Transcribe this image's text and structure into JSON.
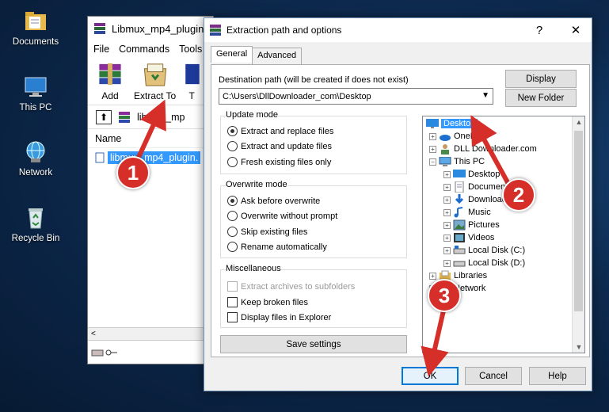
{
  "desktop": {
    "icons": [
      {
        "label": "Documents",
        "icon": "documents-folder-icon"
      },
      {
        "label": "This PC",
        "icon": "computer-icon"
      },
      {
        "label": "Network",
        "icon": "network-icon"
      },
      {
        "label": "Recycle Bin",
        "icon": "recycle-bin-icon"
      }
    ]
  },
  "winrar": {
    "title": "Libmux_mp4_plugin",
    "menu": [
      "File",
      "Commands",
      "Tools"
    ],
    "toolbar": {
      "add": "Add",
      "extract_to": "Extract To",
      "test": "T"
    },
    "path": "libmux_mp",
    "list_header": "Name",
    "file": "libmux_mp4_plugin.",
    "hscroll": "<"
  },
  "dialog": {
    "title": "Extraction path and options",
    "help": "?",
    "close": "✕",
    "tabs": [
      "General",
      "Advanced"
    ],
    "destination_label": "Destination path (will be created if does not exist)",
    "destination_value": "C:\\Users\\DllDownloader_com\\Desktop",
    "display_button": "Display",
    "new_folder_button": "New Folder",
    "update_mode": {
      "title": "Update mode",
      "options": [
        "Extract and replace files",
        "Extract and update files",
        "Fresh existing files only"
      ],
      "selected": 0
    },
    "overwrite_mode": {
      "title": "Overwrite mode",
      "options": [
        "Ask before overwrite",
        "Overwrite without prompt",
        "Skip existing files",
        "Rename automatically"
      ],
      "selected": 0
    },
    "misc": {
      "title": "Miscellaneous",
      "options": [
        "Extract archives to subfolders",
        "Keep broken files",
        "Display files in Explorer"
      ]
    },
    "save_settings": "Save settings",
    "ok": "OK",
    "cancel": "Cancel",
    "help_button": "Help",
    "tree": {
      "desktop": "Desktop",
      "onedrive": "OneD",
      "user": "DLL Downloader.com",
      "this_pc": "This PC",
      "pc_items": [
        "Desktop",
        "Documents",
        "Downloads",
        "Music",
        "Pictures",
        "Videos",
        "Local Disk (C:)",
        "Local Disk (D:)"
      ],
      "libraries": "Libraries",
      "network": "Network"
    }
  },
  "annotations": {
    "step1": "1",
    "step2": "2",
    "step3": "3",
    "color": "#d62f2a"
  }
}
